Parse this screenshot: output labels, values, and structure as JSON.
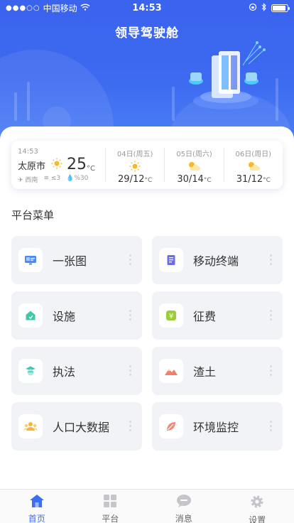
{
  "status_bar": {
    "carrier": "中国移动",
    "time": "14:53"
  },
  "header": {
    "title": "领导驾驶舱"
  },
  "weather": {
    "now": {
      "time": "14:53",
      "city": "太原市",
      "temp": "25",
      "unit": "°C",
      "wind_dir": "西南",
      "wind_level": "≤3",
      "humidity": "%30",
      "icon": "sunny-icon"
    },
    "forecast": [
      {
        "date": "04日(周五)",
        "temp": "29/12",
        "unit": "°C",
        "icon": "sunny-icon"
      },
      {
        "date": "05日(周六)",
        "temp": "30/14",
        "unit": "°C",
        "icon": "partly-cloudy-icon"
      },
      {
        "date": "06日(周日)",
        "temp": "31/12",
        "unit": "°C",
        "icon": "partly-cloudy-icon"
      }
    ]
  },
  "menu": {
    "title": "平台菜单",
    "items": [
      {
        "label": "一张图",
        "icon": "map-screen-icon"
      },
      {
        "label": "移动终端",
        "icon": "document-icon"
      },
      {
        "label": "设施",
        "icon": "facility-house-icon"
      },
      {
        "label": "征费",
        "icon": "yuan-fee-icon"
      },
      {
        "label": "执法",
        "icon": "officer-icon"
      },
      {
        "label": "渣土",
        "icon": "mountain-muck-icon"
      },
      {
        "label": "人口大数据",
        "icon": "population-icon"
      },
      {
        "label": "环境监控",
        "icon": "leaf-icon"
      }
    ]
  },
  "tabs": [
    {
      "label": "首页",
      "icon": "home-icon",
      "active": true
    },
    {
      "label": "平台",
      "icon": "grid-icon",
      "active": false
    },
    {
      "label": "消息",
      "icon": "message-icon",
      "active": false
    },
    {
      "label": "设置",
      "icon": "gear-icon",
      "active": false
    }
  ],
  "colors": {
    "primary": "#3b6ff0",
    "header_bg": "#3d6af0",
    "card_bg": "#f2f3f7"
  }
}
